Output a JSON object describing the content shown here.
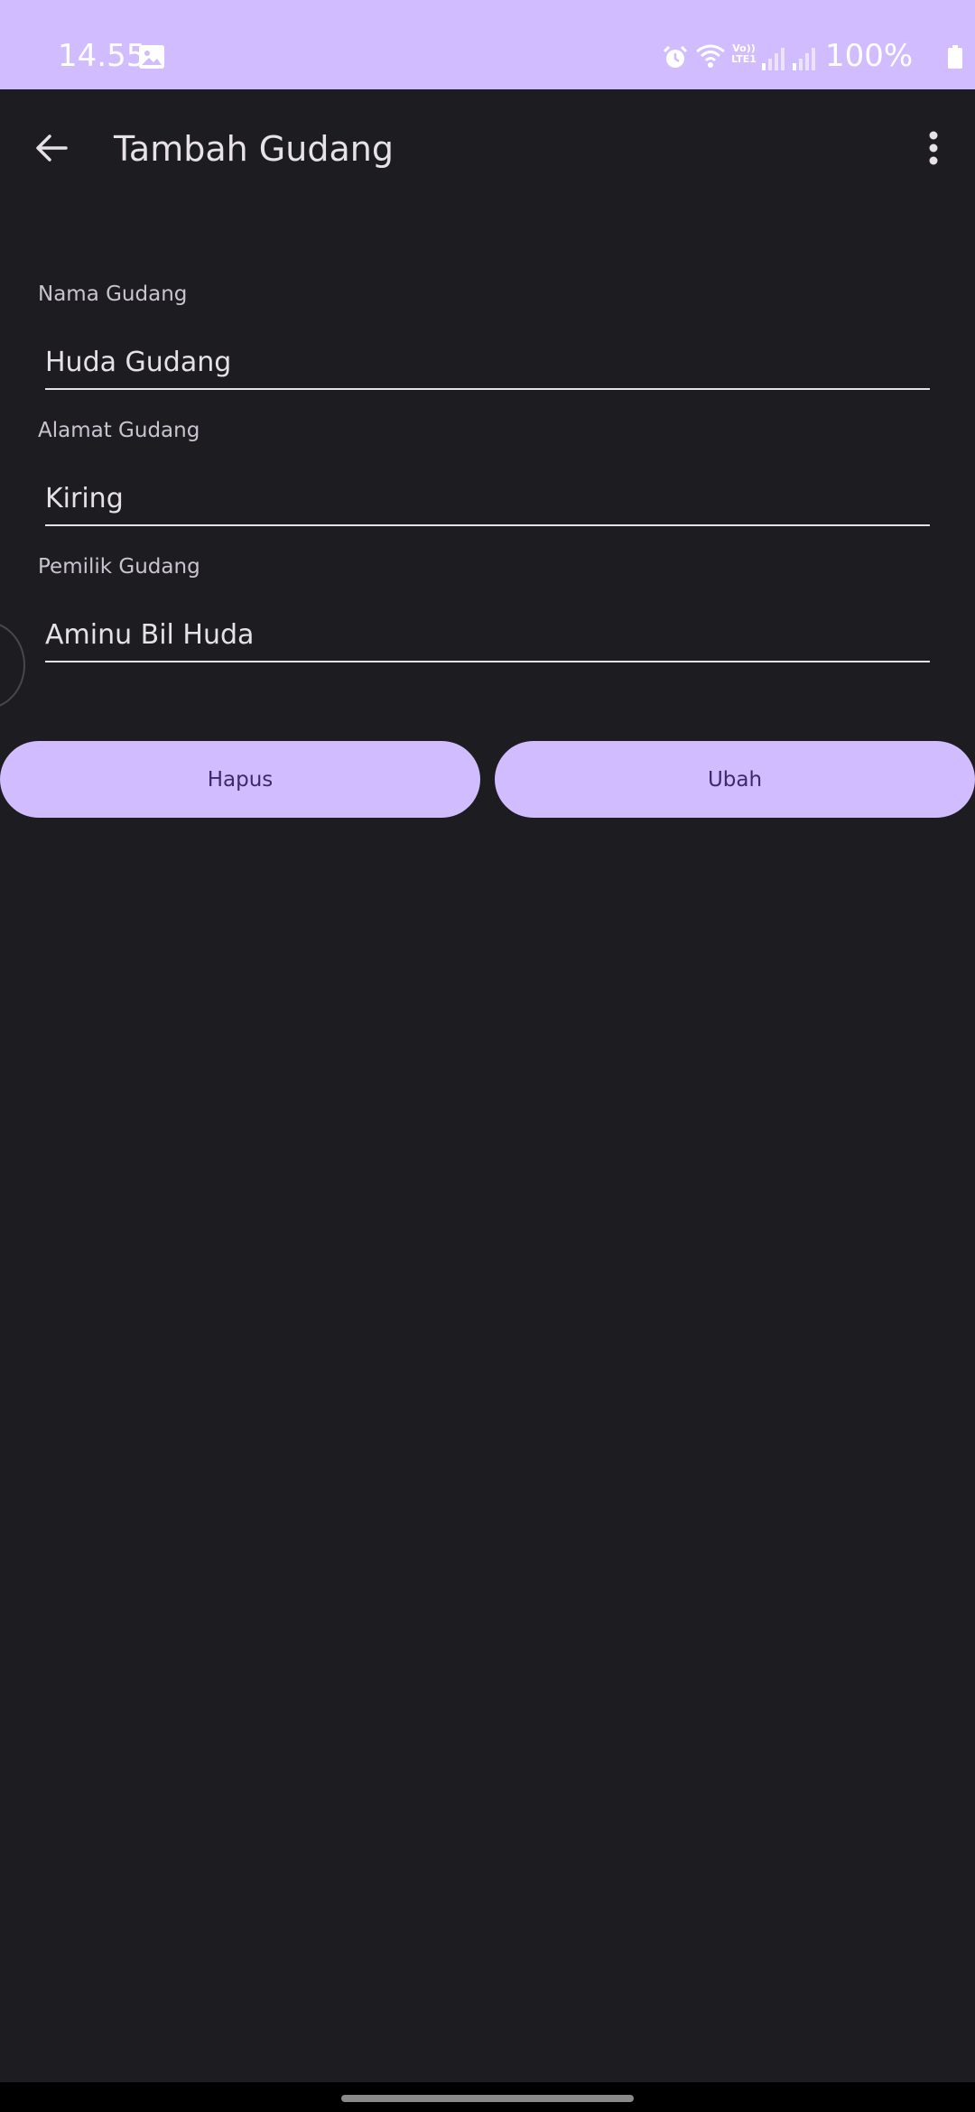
{
  "status_bar": {
    "time": "14.55",
    "volte_label": "Vo))\nLTE1",
    "battery_percent": "100%",
    "icons": [
      "gallery-icon",
      "alarm-icon",
      "wifi-icon",
      "volte-icon",
      "signal-icon",
      "signal-icon",
      "battery-icon"
    ]
  },
  "app_bar": {
    "title": "Tambah Gudang",
    "back_icon": "arrow-back-icon",
    "menu_icon": "more-vert-icon"
  },
  "form": {
    "fields": [
      {
        "label": "Nama Gudang",
        "value": "Huda Gudang"
      },
      {
        "label": "Alamat Gudang",
        "value": "Kiring"
      },
      {
        "label": "Pemilik Gudang",
        "value": "Aminu Bil Huda"
      }
    ]
  },
  "actions": {
    "delete_label": "Hapus",
    "update_label": "Ubah"
  },
  "colors": {
    "accent": "#d0bcff",
    "background": "#1d1c21",
    "on_accent": "#3b2b6b",
    "text": "#e6e1e6"
  }
}
